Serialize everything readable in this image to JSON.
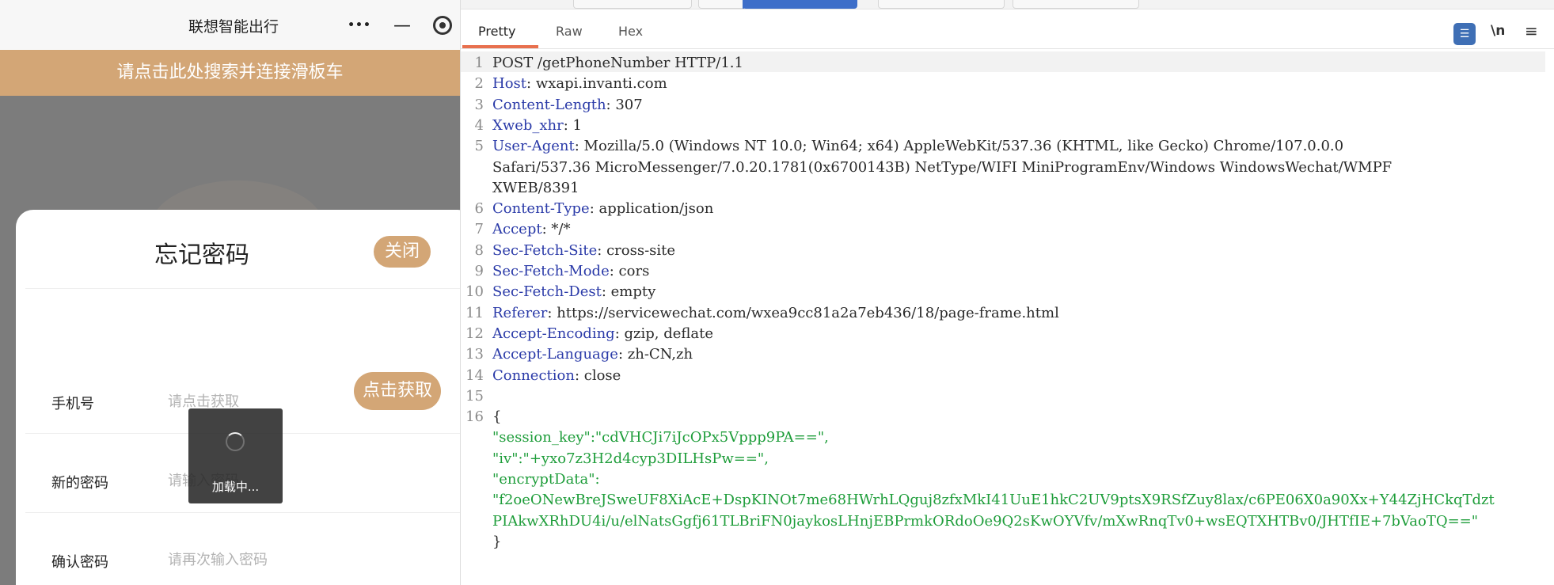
{
  "miniprogram": {
    "title": "联想智能出行",
    "capsule": {
      "more_icon": "•••",
      "minimize_icon": "—",
      "close_icon": "target-icon"
    },
    "banner": "请点击此处搜索并连接滑板车",
    "dialog": {
      "title": "忘记密码",
      "close_label": "关闭",
      "rows": [
        {
          "label": "手机号",
          "placeholder": "请点击获取"
        },
        {
          "label": "新的密码",
          "placeholder": "请输入密码"
        },
        {
          "label": "确认密码",
          "placeholder": "请再次输入密码"
        }
      ],
      "get_button": "点击获取"
    },
    "toast": {
      "text": "加载中..."
    },
    "colors": {
      "accent": "#d3a676",
      "overlay": "#7c7c7c"
    }
  },
  "viewer": {
    "tabs": [
      "Pretty",
      "Raw",
      "Hex"
    ],
    "active_tab": "Pretty",
    "icons": {
      "wrap": "☰",
      "newline": "\\n",
      "menu": "≡"
    },
    "lines": [
      {
        "n": "1",
        "text": "POST /getPhoneNumber HTTP/1.1"
      },
      {
        "n": "2",
        "key": "Host",
        "value": " wxapi.invanti.com"
      },
      {
        "n": "3",
        "key": "Content-Length",
        "value": " 307"
      },
      {
        "n": "4",
        "key": "Xweb_xhr",
        "value": " 1"
      },
      {
        "n": "5",
        "key": "User-Agent",
        "value": " Mozilla/5.0 (Windows NT 10.0; Win64; x64) AppleWebKit/537.36 (KHTML, like Gecko) Chrome/107.0.0.0"
      },
      {
        "n": "",
        "text": "Safari/537.36 MicroMessenger/7.0.20.1781(0x6700143B) NetType/WIFI MiniProgramEnv/Windows WindowsWechat/WMPF"
      },
      {
        "n": "",
        "text": "XWEB/8391"
      },
      {
        "n": "6",
        "key": "Content-Type",
        "value": " application/json"
      },
      {
        "n": "7",
        "key": "Accept",
        "value": " */*"
      },
      {
        "n": "8",
        "key": "Sec-Fetch-Site",
        "value": " cross-site"
      },
      {
        "n": "9",
        "key": "Sec-Fetch-Mode",
        "value": " cors"
      },
      {
        "n": "10",
        "key": "Sec-Fetch-Dest",
        "value": " empty"
      },
      {
        "n": "11",
        "key": "Referer",
        "value": " https://servicewechat.com/wxea9cc81a2a7eb436/18/page-frame.html"
      },
      {
        "n": "12",
        "key": "Accept-Encoding",
        "value": " gzip, deflate"
      },
      {
        "n": "13",
        "key": "Accept-Language",
        "value": " zh-CN,zh"
      },
      {
        "n": "14",
        "key": "Connection",
        "value": " close"
      },
      {
        "n": "15",
        "text": ""
      },
      {
        "n": "16",
        "text": "{"
      },
      {
        "n": "",
        "json": "  \"session_key\":\"cdVHCJi7iJcOPx5Vppp9PA==\","
      },
      {
        "n": "",
        "json": "  \"iv\":\"+yxo7z3H2d4cyp3DILHsPw==\","
      },
      {
        "n": "",
        "json": "  \"encryptData\":"
      },
      {
        "n": "",
        "json": "  \"f2oeONewBreJSweUF8XiAcE+DspKINOt7me68HWrhLQguj8zfxMkI41UuE1hkC2UV9ptsX9RSfZuy8lax/c6PE06X0a90Xx+Y44ZjHCkqTdzt"
      },
      {
        "n": "",
        "json": "  PIAkwXRhDU4i/u/elNatsGgfj61TLBriFN0jaykosLHnjEBPrmkORdoOe9Q2sKwOYVfv/mXwRnqTv0+wsEQTXHTBv0/JHTfIE+7bVaoTQ==\""
      },
      {
        "n": "",
        "text": "}"
      }
    ]
  }
}
